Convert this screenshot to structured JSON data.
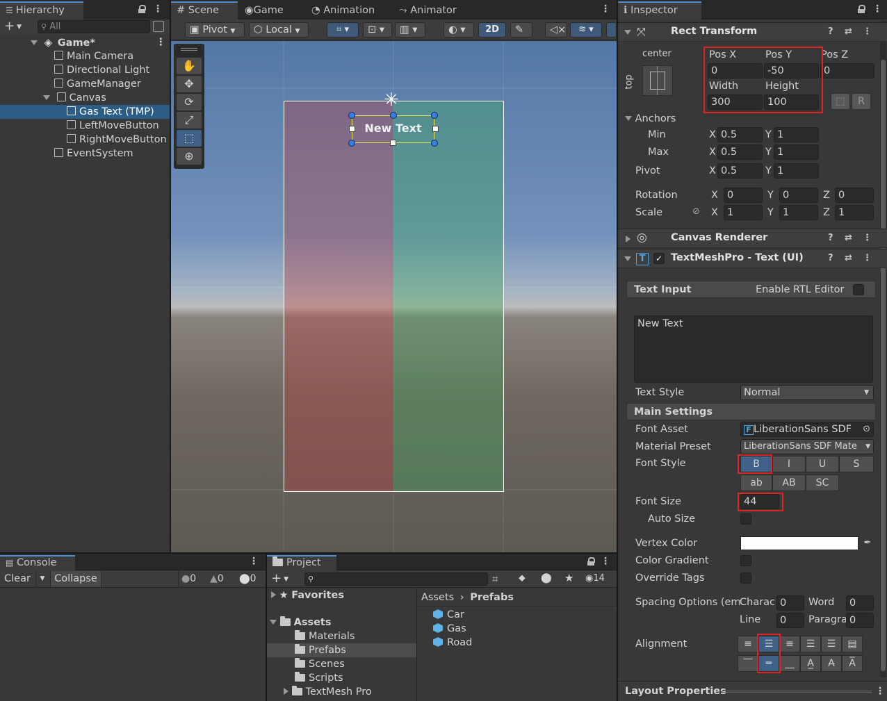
{
  "hierarchy": {
    "tab": "Hierarchy",
    "search_placeholder": "All",
    "root": "Game*",
    "items": [
      {
        "label": "Main Camera"
      },
      {
        "label": "Directional Light"
      },
      {
        "label": "GameManager"
      },
      {
        "label": "Canvas"
      },
      {
        "label": "Gas Text (TMP)"
      },
      {
        "label": "LeftMoveButton"
      },
      {
        "label": "RightMoveButton"
      },
      {
        "label": "EventSystem"
      }
    ]
  },
  "scene": {
    "tabs": [
      "Scene",
      "Game",
      "Animation",
      "Animator"
    ],
    "pivot": "Pivot",
    "local": "Local",
    "mode_2d": "2D",
    "text_object": "New Text"
  },
  "inspector": {
    "tab": "Inspector",
    "rect_transform": {
      "title": "Rect Transform",
      "anchor_label": "center",
      "anchor_side": "top",
      "pos_x_label": "Pos X",
      "pos_x": "0",
      "pos_y_label": "Pos Y",
      "pos_y": "-50",
      "pos_z_label": "Pos Z",
      "pos_z": "0",
      "width_label": "Width",
      "width": "300",
      "height_label": "Height",
      "height": "100",
      "raw_button": "R",
      "anchors_label": "Anchors",
      "min_label": "Min",
      "min_x": "0.5",
      "min_y": "1",
      "max_label": "Max",
      "max_x": "0.5",
      "max_y": "1",
      "pivot_label": "Pivot",
      "pivot_x": "0.5",
      "pivot_y": "1",
      "rotation_label": "Rotation",
      "rot_x": "0",
      "rot_y": "0",
      "rot_z": "0",
      "scale_label": "Scale",
      "scale_x": "1",
      "scale_y": "1",
      "scale_z": "1",
      "x": "X",
      "y": "Y",
      "z": "Z"
    },
    "canvas_renderer": {
      "title": "Canvas Renderer"
    },
    "tmp": {
      "title": "TextMeshPro - Text (UI)",
      "text_input_label": "Text Input",
      "rtl_label": "Enable RTL Editor",
      "text_value": "New Text",
      "text_style_label": "Text Style",
      "text_style_value": "Normal",
      "main_settings": "Main Settings",
      "font_asset_label": "Font Asset",
      "font_asset_value": "LiberationSans SDF",
      "material_preset_label": "Material Preset",
      "material_preset_value": "LiberationSans SDF Mate",
      "font_style_label": "Font Style",
      "style_b": "B",
      "style_i": "I",
      "style_u": "U",
      "style_s": "S",
      "style_ab": "ab",
      "style_AB": "AB",
      "style_sc": "SC",
      "font_size_label": "Font Size",
      "font_size_value": "44",
      "auto_size_label": "Auto Size",
      "vertex_color_label": "Vertex Color",
      "color_gradient_label": "Color Gradient",
      "override_tags_label": "Override Tags",
      "spacing_label": "Spacing Options (em",
      "charac_label": "Charac",
      "charac_value": "0",
      "word_label": "Word",
      "word_value": "0",
      "line_label": "Line",
      "line_value": "0",
      "paragraph_label": "Paragra",
      "paragraph_value": "0",
      "alignment_label": "Alignment"
    },
    "layout_properties": "Layout Properties"
  },
  "console": {
    "tab": "Console",
    "clear": "Clear",
    "collapse": "Collapse",
    "info_count": "0",
    "warn_count": "0",
    "error_count": "0"
  },
  "project": {
    "tab": "Project",
    "hidden_count": "14",
    "favorites": "Favorites",
    "assets": "Assets",
    "folders": [
      "Materials",
      "Prefabs",
      "Scenes",
      "Scripts",
      "TextMesh Pro"
    ],
    "breadcrumb_root": "Assets",
    "breadcrumb_current": "Prefabs",
    "files": [
      "Car",
      "Gas",
      "Road"
    ]
  },
  "colors": {
    "selection": "#2c5d87",
    "accent": "#4b8fd6",
    "highlight": "#e02525"
  }
}
